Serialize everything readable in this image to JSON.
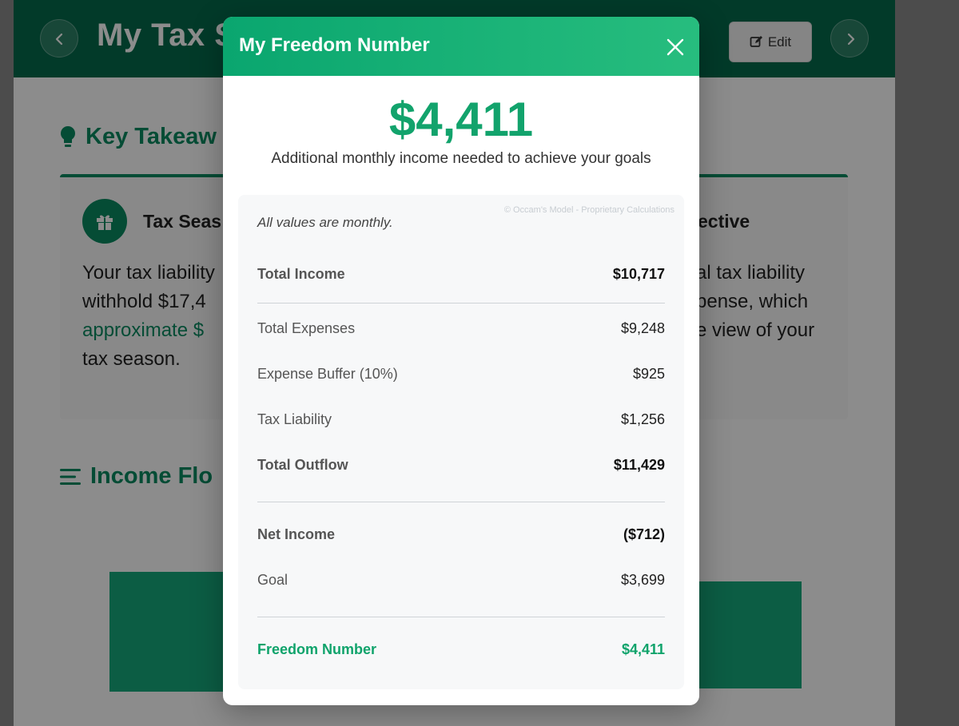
{
  "background": {
    "header_title": "My Tax S",
    "edit_label": "Edit",
    "key_takeaways_heading": "Key Takeaw",
    "card_left_title": "Tax Seas",
    "card_left_lines": [
      "Your tax liability",
      "withhold $17,4",
      "approximate $",
      "tax season."
    ],
    "card_right_title": "ective",
    "card_right_lines": [
      "al tax liability",
      "pense, which",
      "e view of your"
    ],
    "income_flow_heading": "Income Flo"
  },
  "modal": {
    "title": "My Freedom Number",
    "amount": "$4,411",
    "subtitle": "Additional monthly income needed to achieve your goals",
    "watermark": "© Occam's Model - Proprietary Calculations",
    "note": "All values are monthly.",
    "rows": [
      {
        "label": "Total Income",
        "value": "$10,717"
      },
      {
        "label": "Total Expenses",
        "value": "$9,248"
      },
      {
        "label": "Expense Buffer (10%)",
        "value": "$925"
      },
      {
        "label": "Tax Liability",
        "value": "$1,256"
      },
      {
        "label": "Total Outflow",
        "value": "$11,429"
      },
      {
        "label": "Net Income",
        "value": "($712)"
      },
      {
        "label": "Goal",
        "value": "$3,699"
      },
      {
        "label": "Freedom Number",
        "value": "$4,411"
      }
    ]
  },
  "colors": {
    "brand_green": "#0a8a61",
    "header_dark_green": "#056b4b",
    "freedom_green": "#12a36c"
  },
  "icons": {
    "prev": "chevron-left-icon",
    "next": "chevron-right-icon",
    "edit": "edit-icon",
    "takeaways": "lightbulb-icon",
    "tax_card": "gift-icon",
    "income_flow": "bars-icon",
    "close": "close-icon"
  }
}
